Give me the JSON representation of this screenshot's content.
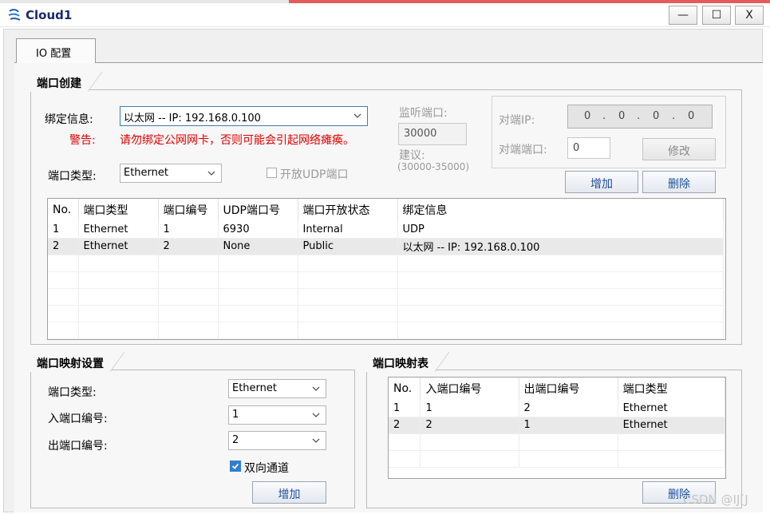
{
  "window": {
    "title": "Cloud1",
    "minimize_glyph": "—",
    "maximize_glyph": "☐",
    "close_glyph": "X"
  },
  "tabs": [
    {
      "label": "IO 配置"
    }
  ],
  "port_create": {
    "title": "端口创建",
    "bind_label": "绑定信息:",
    "bind_value": "以太网 -- IP: 192.168.0.100",
    "warning_label": "警告:",
    "warning_text": "请勿绑定公网网卡，否则可能会引起网络瘫痪。",
    "port_type_label": "端口类型:",
    "port_type_value": "Ethernet",
    "udp_checkbox_label": "开放UDP端口",
    "udp_checked": false,
    "listen_port_label": "监听端口:",
    "listen_port_value": "30000",
    "suggest_label": "建议:",
    "suggest_range": "(30000-35000)",
    "peer_ip_label": "对端IP:",
    "peer_ip_octets": [
      "0",
      "0",
      "0",
      "0"
    ],
    "peer_port_label": "对端端口:",
    "peer_port_value": "0",
    "modify_button": "修改",
    "add_button": "增加",
    "delete_button": "删除",
    "table": {
      "columns": [
        "No.",
        "端口类型",
        "端口编号",
        "UDP端口号",
        "端口开放状态",
        "绑定信息"
      ],
      "rows": [
        [
          "1",
          "Ethernet",
          "1",
          "6930",
          "Internal",
          "UDP"
        ],
        [
          "2",
          "Ethernet",
          "2",
          "None",
          "Public",
          "以太网 -- IP: 192.168.0.100"
        ]
      ],
      "selected_row": 2
    }
  },
  "port_map_settings": {
    "title": "端口映射设置",
    "port_type_label": "端口类型:",
    "port_type_value": "Ethernet",
    "in_port_label": "入端口编号:",
    "in_port_value": "1",
    "out_port_label": "出端口编号:",
    "out_port_value": "2",
    "bidirectional_label": "双向通道",
    "bidirectional_checked": true,
    "add_button": "增加"
  },
  "port_map_table": {
    "title": "端口映射表",
    "columns": [
      "No.",
      "入端口编号",
      "出端口编号",
      "端口类型"
    ],
    "rows": [
      [
        "1",
        "1",
        "2",
        "Ethernet"
      ],
      [
        "2",
        "2",
        "1",
        "Ethernet"
      ]
    ],
    "selected_row": 2,
    "delete_button": "删除"
  },
  "watermark": "CSDN @IJ[J",
  "colors": {
    "accent_text": "#1c4e9c",
    "warning": "#e00000",
    "title_text": "#1a2a6c"
  }
}
